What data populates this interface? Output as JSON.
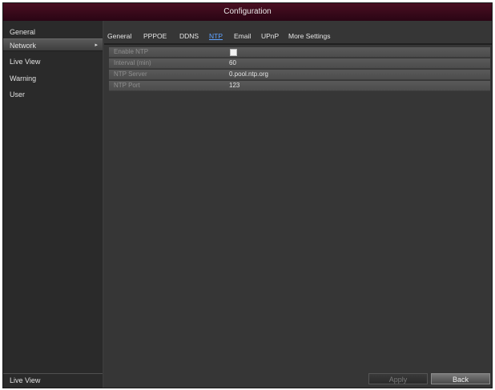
{
  "title": "Configuration",
  "sidebar": {
    "items": [
      {
        "label": "General"
      },
      {
        "label": "Network"
      },
      {
        "label": "Live View"
      },
      {
        "label": "Warning"
      },
      {
        "label": "User"
      }
    ],
    "active_arrow": "▸",
    "bottom_label": "Live View"
  },
  "tabs": [
    {
      "label": "General"
    },
    {
      "label": "PPPOE"
    },
    {
      "label": "DDNS"
    },
    {
      "label": "NTP"
    },
    {
      "label": "Email"
    },
    {
      "label": "UPnP"
    },
    {
      "label": "More Settings"
    }
  ],
  "active_tab": "NTP",
  "ntp": {
    "rows": [
      {
        "label": "Enable NTP",
        "value": ""
      },
      {
        "label": "Interval (min)",
        "value": "60"
      },
      {
        "label": "NTP Server",
        "value": "0.pool.ntp.org"
      },
      {
        "label": "NTP Port",
        "value": "123"
      }
    ],
    "enable_checked": false
  },
  "buttons": {
    "apply": "Apply",
    "back": "Back"
  },
  "colors": {
    "titlebar": "#3a0a1c",
    "accent_tab": "#5ea2ff",
    "panel": "#363636"
  }
}
